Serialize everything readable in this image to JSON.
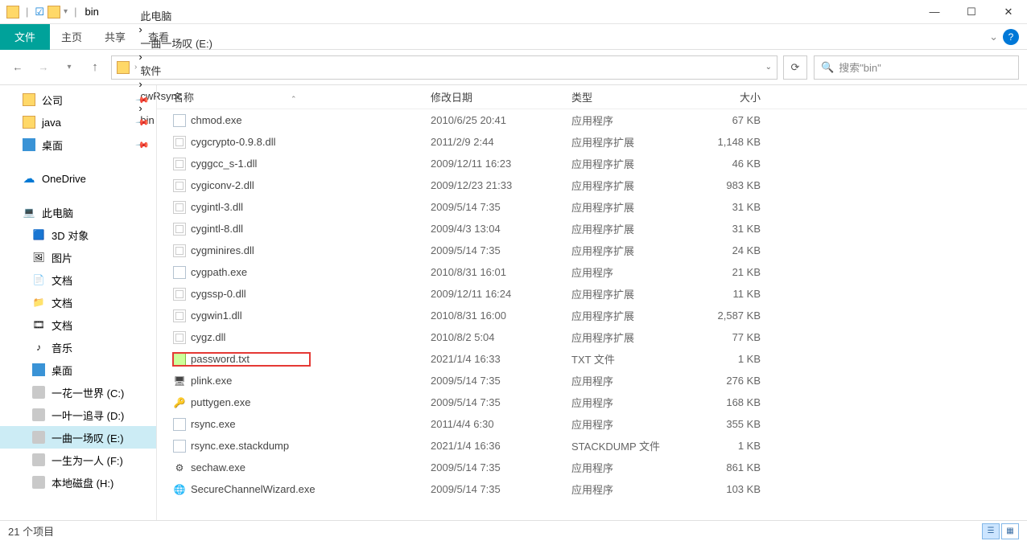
{
  "window": {
    "title": "bin"
  },
  "menubar": {
    "file": "文件",
    "home": "主页",
    "share": "共享",
    "view": "查看"
  },
  "breadcrumbs": [
    "此电脑",
    "一曲一场叹 (E:)",
    "软件",
    "cwRsync",
    "bin"
  ],
  "search": {
    "placeholder": "搜索\"bin\""
  },
  "nav": {
    "quick": [
      {
        "label": "公司",
        "icon": "folder",
        "pinned": true
      },
      {
        "label": "java",
        "icon": "folder",
        "pinned": true
      },
      {
        "label": "桌面",
        "icon": "desktop",
        "pinned": true
      }
    ],
    "onedrive": "OneDrive",
    "pc": "此电脑",
    "pcitems": [
      {
        "label": "3D 对象",
        "icon": "3d"
      },
      {
        "label": "图片",
        "icon": "pic"
      },
      {
        "label": "文档",
        "icon": "doc"
      },
      {
        "label": "文档",
        "icon": "doc2"
      },
      {
        "label": "文档",
        "icon": "vid"
      },
      {
        "label": "音乐",
        "icon": "music"
      },
      {
        "label": "桌面",
        "icon": "desktop"
      }
    ],
    "drives": [
      {
        "label": "一花一世界 (C:)",
        "sel": false
      },
      {
        "label": "一叶一追寻 (D:)",
        "sel": false
      },
      {
        "label": "一曲一场叹 (E:)",
        "sel": true
      },
      {
        "label": "一生为一人 (F:)",
        "sel": false
      },
      {
        "label": "本地磁盘 (H:)",
        "sel": false
      }
    ]
  },
  "columns": {
    "name": "名称",
    "date": "修改日期",
    "type": "类型",
    "size": "大小"
  },
  "files": [
    {
      "name": "chmod.exe",
      "icon": "exe",
      "date": "2010/6/25 20:41",
      "type": "应用程序",
      "size": "67 KB"
    },
    {
      "name": "cygcrypto-0.9.8.dll",
      "icon": "dll",
      "date": "2011/2/9 2:44",
      "type": "应用程序扩展",
      "size": "1,148 KB"
    },
    {
      "name": "cyggcc_s-1.dll",
      "icon": "dll",
      "date": "2009/12/11 16:23",
      "type": "应用程序扩展",
      "size": "46 KB"
    },
    {
      "name": "cygiconv-2.dll",
      "icon": "dll",
      "date": "2009/12/23 21:33",
      "type": "应用程序扩展",
      "size": "983 KB"
    },
    {
      "name": "cygintl-3.dll",
      "icon": "dll",
      "date": "2009/5/14 7:35",
      "type": "应用程序扩展",
      "size": "31 KB"
    },
    {
      "name": "cygintl-8.dll",
      "icon": "dll",
      "date": "2009/4/3 13:04",
      "type": "应用程序扩展",
      "size": "31 KB"
    },
    {
      "name": "cygminires.dll",
      "icon": "dll",
      "date": "2009/5/14 7:35",
      "type": "应用程序扩展",
      "size": "24 KB"
    },
    {
      "name": "cygpath.exe",
      "icon": "exe",
      "date": "2010/8/31 16:01",
      "type": "应用程序",
      "size": "21 KB"
    },
    {
      "name": "cygssp-0.dll",
      "icon": "dll",
      "date": "2009/12/11 16:24",
      "type": "应用程序扩展",
      "size": "11 KB"
    },
    {
      "name": "cygwin1.dll",
      "icon": "dll",
      "date": "2010/8/31 16:00",
      "type": "应用程序扩展",
      "size": "2,587 KB"
    },
    {
      "name": "cygz.dll",
      "icon": "dll",
      "date": "2010/8/2 5:04",
      "type": "应用程序扩展",
      "size": "77 KB"
    },
    {
      "name": "password.txt",
      "icon": "txt",
      "date": "2021/1/4 16:33",
      "type": "TXT 文件",
      "size": "1 KB",
      "highlight": true
    },
    {
      "name": "plink.exe",
      "icon": "plink",
      "date": "2009/5/14 7:35",
      "type": "应用程序",
      "size": "276 KB"
    },
    {
      "name": "puttygen.exe",
      "icon": "putty",
      "date": "2009/5/14 7:35",
      "type": "应用程序",
      "size": "168 KB"
    },
    {
      "name": "rsync.exe",
      "icon": "exe",
      "date": "2011/4/4 6:30",
      "type": "应用程序",
      "size": "355 KB"
    },
    {
      "name": "rsync.exe.stackdump",
      "icon": "blank",
      "date": "2021/1/4 16:36",
      "type": "STACKDUMP 文件",
      "size": "1 KB"
    },
    {
      "name": "sechaw.exe",
      "icon": "sechaw",
      "date": "2009/5/14 7:35",
      "type": "应用程序",
      "size": "861 KB"
    },
    {
      "name": "SecureChannelWizard.exe",
      "icon": "globe",
      "date": "2009/5/14 7:35",
      "type": "应用程序",
      "size": "103 KB"
    }
  ],
  "status": {
    "count": "21 个项目"
  }
}
